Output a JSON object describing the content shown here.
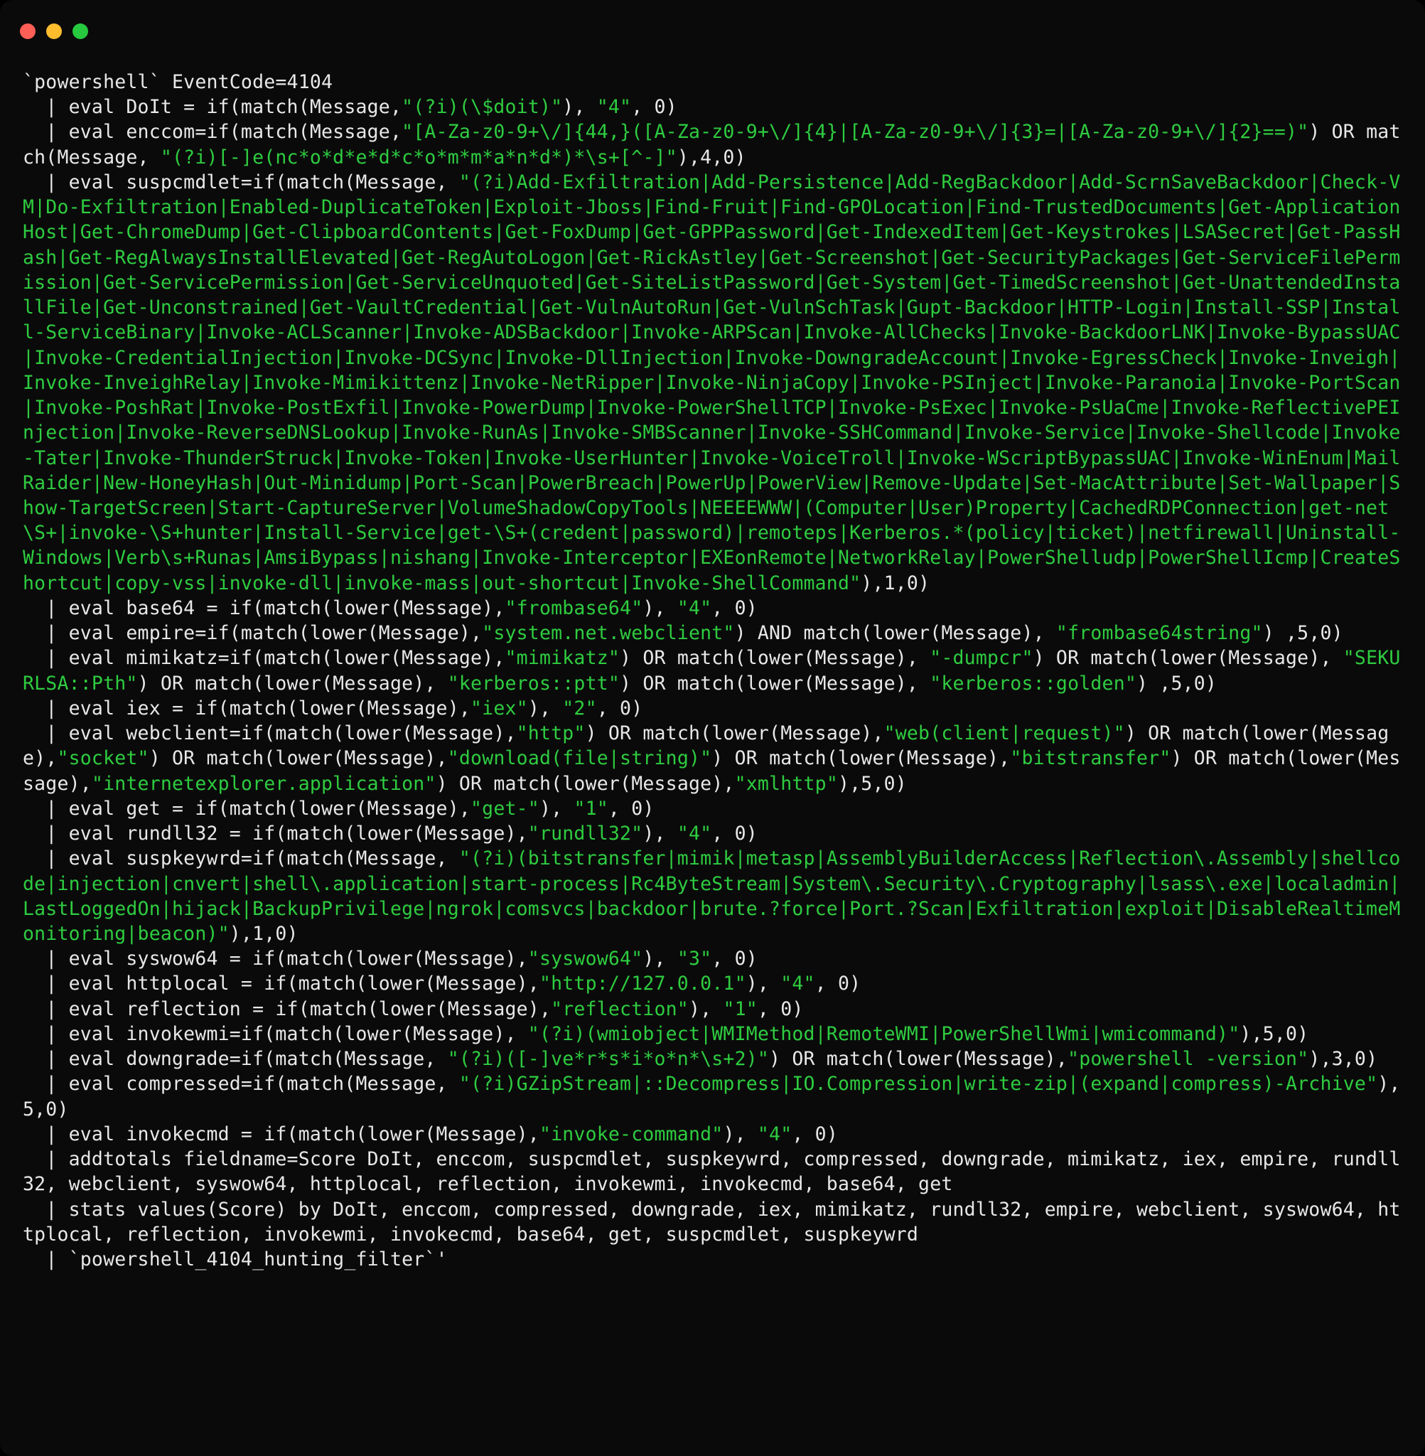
{
  "titlebar": {
    "buttons": [
      "close",
      "minimize",
      "zoom"
    ]
  },
  "code": {
    "tokens": [
      {
        "c": "plain",
        "t": "`powershell` EventCode=4104\n  | eval DoIt = if(match(Message,"
      },
      {
        "c": "str",
        "t": "\"(?i)(\\$doit)\""
      },
      {
        "c": "plain",
        "t": "), "
      },
      {
        "c": "str",
        "t": "\"4\""
      },
      {
        "c": "plain",
        "t": ", 0)\n  | eval enccom=if(match(Message,"
      },
      {
        "c": "str",
        "t": "\"[A-Za-z0-9+\\/]{44,}([A-Za-z0-9+\\/]{4}|[A-Za-z0-9+\\/]{3}=|[A-Za-z0-9+\\/]{2}==)\""
      },
      {
        "c": "plain",
        "t": ") OR match(Message, "
      },
      {
        "c": "str",
        "t": "\"(?i)[-]e(nc*o*d*e*d*c*o*m*m*a*n*d*)*\\s+[^-]\""
      },
      {
        "c": "plain",
        "t": "),4,0)\n  | eval suspcmdlet=if(match(Message, "
      },
      {
        "c": "str",
        "t": "\"(?i)Add-Exfiltration|Add-Persistence|Add-RegBackdoor|Add-ScrnSaveBackdoor|Check-VM|Do-Exfiltration|Enabled-DuplicateToken|Exploit-Jboss|Find-Fruit|Find-GPOLocation|Find-TrustedDocuments|Get-ApplicationHost|Get-ChromeDump|Get-ClipboardContents|Get-FoxDump|Get-GPPPassword|Get-IndexedItem|Get-Keystrokes|LSASecret|Get-PassHash|Get-RegAlwaysInstallElevated|Get-RegAutoLogon|Get-RickAstley|Get-Screenshot|Get-SecurityPackages|Get-ServiceFilePermission|Get-ServicePermission|Get-ServiceUnquoted|Get-SiteListPassword|Get-System|Get-TimedScreenshot|Get-UnattendedInstallFile|Get-Unconstrained|Get-VaultCredential|Get-VulnAutoRun|Get-VulnSchTask|Gupt-Backdoor|HTTP-Login|Install-SSP|Install-ServiceBinary|Invoke-ACLScanner|Invoke-ADSBackdoor|Invoke-ARPScan|Invoke-AllChecks|Invoke-BackdoorLNK|Invoke-BypassUAC|Invoke-CredentialInjection|Invoke-DCSync|Invoke-DllInjection|Invoke-DowngradeAccount|Invoke-EgressCheck|Invoke-Inveigh|Invoke-InveighRelay|Invoke-Mimikittenz|Invoke-NetRipper|Invoke-NinjaCopy|Invoke-PSInject|Invoke-Paranoia|Invoke-PortScan|Invoke-PoshRat|Invoke-PostExfil|Invoke-PowerDump|Invoke-PowerShellTCP|Invoke-PsExec|Invoke-PsUaCme|Invoke-ReflectivePEInjection|Invoke-ReverseDNSLookup|Invoke-RunAs|Invoke-SMBScanner|Invoke-SSHCommand|Invoke-Service|Invoke-Shellcode|Invoke-Tater|Invoke-ThunderStruck|Invoke-Token|Invoke-UserHunter|Invoke-VoiceTroll|Invoke-WScriptBypassUAC|Invoke-WinEnum|MailRaider|New-HoneyHash|Out-Minidump|Port-Scan|PowerBreach|PowerUp|PowerView|Remove-Update|Set-MacAttribute|Set-Wallpaper|Show-TargetScreen|Start-CaptureServer|VolumeShadowCopyTools|NEEEEWWW|(Computer|User)Property|CachedRDPConnection|get-net\\S+|invoke-\\S+hunter|Install-Service|get-\\S+(credent|password)|remoteps|Kerberos.*(policy|ticket)|netfirewall|Uninstall-Windows|Verb\\s+Runas|AmsiBypass|nishang|Invoke-Interceptor|EXEonRemote|NetworkRelay|PowerShelludp|PowerShellIcmp|CreateShortcut|copy-vss|invoke-dll|invoke-mass|out-shortcut|Invoke-ShellCommand\""
      },
      {
        "c": "plain",
        "t": "),1,0)\n  | eval base64 = if(match(lower(Message),"
      },
      {
        "c": "str",
        "t": "\"frombase64\""
      },
      {
        "c": "plain",
        "t": "), "
      },
      {
        "c": "str",
        "t": "\"4\""
      },
      {
        "c": "plain",
        "t": ", 0)\n  | eval empire=if(match(lower(Message),"
      },
      {
        "c": "str",
        "t": "\"system.net.webclient\""
      },
      {
        "c": "plain",
        "t": ") AND match(lower(Message), "
      },
      {
        "c": "str",
        "t": "\"frombase64string\""
      },
      {
        "c": "plain",
        "t": ") ,5,0)\n  | eval mimikatz=if(match(lower(Message),"
      },
      {
        "c": "str",
        "t": "\"mimikatz\""
      },
      {
        "c": "plain",
        "t": ") OR match(lower(Message), "
      },
      {
        "c": "str",
        "t": "\"-dumpcr\""
      },
      {
        "c": "plain",
        "t": ") OR match(lower(Message), "
      },
      {
        "c": "str",
        "t": "\"SEKURLSA::Pth\""
      },
      {
        "c": "plain",
        "t": ") OR match(lower(Message), "
      },
      {
        "c": "str",
        "t": "\"kerberos::ptt\""
      },
      {
        "c": "plain",
        "t": ") OR match(lower(Message), "
      },
      {
        "c": "str",
        "t": "\"kerberos::golden\""
      },
      {
        "c": "plain",
        "t": ") ,5,0)\n  | eval iex = if(match(lower(Message),"
      },
      {
        "c": "str",
        "t": "\"iex\""
      },
      {
        "c": "plain",
        "t": "), "
      },
      {
        "c": "str",
        "t": "\"2\""
      },
      {
        "c": "plain",
        "t": ", 0)\n  | eval webclient=if(match(lower(Message),"
      },
      {
        "c": "str",
        "t": "\"http\""
      },
      {
        "c": "plain",
        "t": ") OR match(lower(Message),"
      },
      {
        "c": "str",
        "t": "\"web(client|request)\""
      },
      {
        "c": "plain",
        "t": ") OR match(lower(Message),"
      },
      {
        "c": "str",
        "t": "\"socket\""
      },
      {
        "c": "plain",
        "t": ") OR match(lower(Message),"
      },
      {
        "c": "str",
        "t": "\"download(file|string)\""
      },
      {
        "c": "plain",
        "t": ") OR match(lower(Message),"
      },
      {
        "c": "str",
        "t": "\"bitstransfer\""
      },
      {
        "c": "plain",
        "t": ") OR match(lower(Message),"
      },
      {
        "c": "str",
        "t": "\"internetexplorer.application\""
      },
      {
        "c": "plain",
        "t": ") OR match(lower(Message),"
      },
      {
        "c": "str",
        "t": "\"xmlhttp\""
      },
      {
        "c": "plain",
        "t": "),5,0)\n  | eval get = if(match(lower(Message),"
      },
      {
        "c": "str",
        "t": "\"get-\""
      },
      {
        "c": "plain",
        "t": "), "
      },
      {
        "c": "str",
        "t": "\"1\""
      },
      {
        "c": "plain",
        "t": ", 0)\n  | eval rundll32 = if(match(lower(Message),"
      },
      {
        "c": "str",
        "t": "\"rundll32\""
      },
      {
        "c": "plain",
        "t": "), "
      },
      {
        "c": "str",
        "t": "\"4\""
      },
      {
        "c": "plain",
        "t": ", 0)\n  | eval suspkeywrd=if(match(Message, "
      },
      {
        "c": "str",
        "t": "\"(?i)(bitstransfer|mimik|metasp|AssemblyBuilderAccess|Reflection\\.Assembly|shellcode|injection|cnvert|shell\\.application|start-process|Rc4ByteStream|System\\.Security\\.Cryptography|lsass\\.exe|localadmin|LastLoggedOn|hijack|BackupPrivilege|ngrok|comsvcs|backdoor|brute.?force|Port.?Scan|Exfiltration|exploit|DisableRealtimeMonitoring|beacon)\""
      },
      {
        "c": "plain",
        "t": "),1,0)\n  | eval syswow64 = if(match(lower(Message),"
      },
      {
        "c": "str",
        "t": "\"syswow64\""
      },
      {
        "c": "plain",
        "t": "), "
      },
      {
        "c": "str",
        "t": "\"3\""
      },
      {
        "c": "plain",
        "t": ", 0)\n  | eval httplocal = if(match(lower(Message),"
      },
      {
        "c": "str",
        "t": "\"http://127.0.0.1\""
      },
      {
        "c": "plain",
        "t": "), "
      },
      {
        "c": "str",
        "t": "\"4\""
      },
      {
        "c": "plain",
        "t": ", 0)\n  | eval reflection = if(match(lower(Message),"
      },
      {
        "c": "str",
        "t": "\"reflection\""
      },
      {
        "c": "plain",
        "t": "), "
      },
      {
        "c": "str",
        "t": "\"1\""
      },
      {
        "c": "plain",
        "t": ", 0)\n  | eval invokewmi=if(match(lower(Message), "
      },
      {
        "c": "str",
        "t": "\"(?i)(wmiobject|WMIMethod|RemoteWMI|PowerShellWmi|wmicommand)\""
      },
      {
        "c": "plain",
        "t": "),5,0)\n  | eval downgrade=if(match(Message, "
      },
      {
        "c": "str",
        "t": "\"(?i)([-]ve*r*s*i*o*n*\\s+2)\""
      },
      {
        "c": "plain",
        "t": ") OR match(lower(Message),"
      },
      {
        "c": "str",
        "t": "\"powershell -version\""
      },
      {
        "c": "plain",
        "t": "),3,0)\n  | eval compressed=if(match(Message, "
      },
      {
        "c": "str",
        "t": "\"(?i)GZipStream|::Decompress|IO.Compression|write-zip|(expand|compress)-Archive\""
      },
      {
        "c": "plain",
        "t": "),5,0)\n  | eval invokecmd = if(match(lower(Message),"
      },
      {
        "c": "str",
        "t": "\"invoke-command\""
      },
      {
        "c": "plain",
        "t": "), "
      },
      {
        "c": "str",
        "t": "\"4\""
      },
      {
        "c": "plain",
        "t": ", 0)\n  | addtotals fieldname=Score DoIt, enccom, suspcmdlet, suspkeywrd, compressed, downgrade, mimikatz, iex, empire, rundll32, webclient, syswow64, httplocal, reflection, invokewmi, invokecmd, base64, get\n  | stats values(Score) by DoIt, enccom, compressed, downgrade, iex, mimikatz, rundll32, empire, webclient, syswow64, httplocal, reflection, invokewmi, invokecmd, base64, get, suspcmdlet, suspkeywrd\n  | `powershell_4104_hunting_filter`'"
      }
    ]
  }
}
